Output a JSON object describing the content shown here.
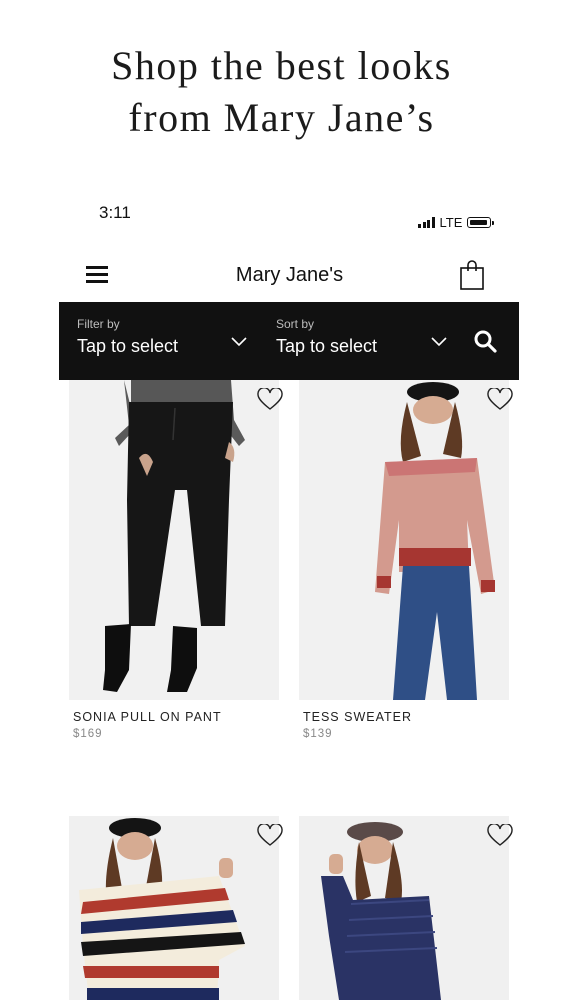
{
  "promo": {
    "line1": "Shop the best looks",
    "line2": "from Mary Jane’s"
  },
  "status_bar": {
    "time": "3:11",
    "network": "LTE"
  },
  "header": {
    "title": "Mary Jane's"
  },
  "filter_bar": {
    "filter_label": "Filter by",
    "filter_value": "Tap to select",
    "sort_label": "Sort by",
    "sort_value": "Tap to select"
  },
  "products": [
    {
      "name": "SONIA PULL ON PANT",
      "price": "$169",
      "color": "#1a1a1a"
    },
    {
      "name": "TESS SWEATER",
      "price": "$139",
      "color": "#b23a35"
    },
    {
      "name": "",
      "price": "",
      "color": "#b03a2e"
    },
    {
      "name": "",
      "price": "",
      "color": "#2f3566"
    }
  ],
  "icons": [
    "hamburger-menu-icon",
    "shopping-bag-icon",
    "chevron-down-icon",
    "search-icon",
    "heart-icon"
  ]
}
